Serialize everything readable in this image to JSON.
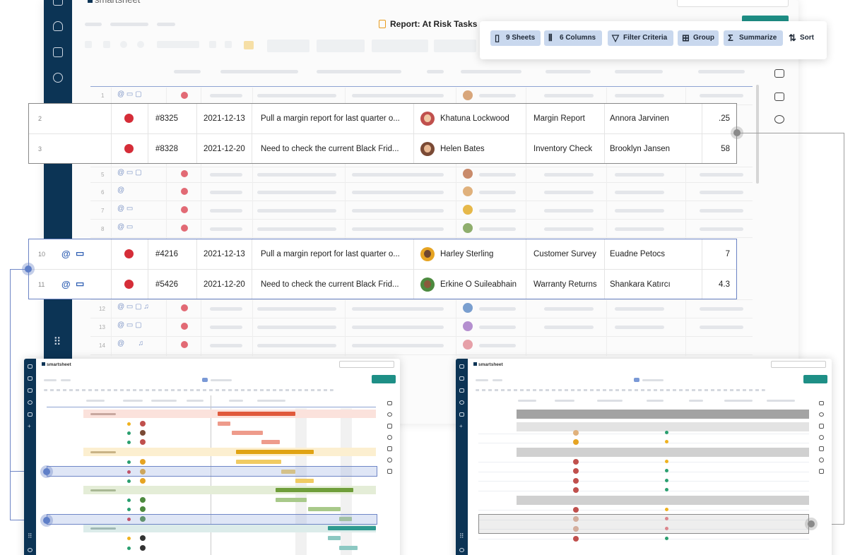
{
  "app": {
    "brand": "smartsheet",
    "mini_brand": "smartsheet"
  },
  "report": {
    "title": "Report: At Risk Tasks"
  },
  "toolbar": {
    "sheets": "9 Sheets",
    "columns": "6 Columns",
    "filter": "Filter Criteria",
    "group": "Group",
    "summarize": "Summarize",
    "sort": "Sort"
  },
  "faded_rows": [
    {
      "num": "1",
      "icons": "@ ▭ ▢"
    },
    {
      "num": "5",
      "icons": "@ ▭ ▢"
    },
    {
      "num": "6",
      "icons": "@"
    },
    {
      "num": "7",
      "icons": "@ ▭"
    },
    {
      "num": "8",
      "icons": "@ ▭"
    },
    {
      "num": "12",
      "icons": "@ ▭ ▢ ♫"
    },
    {
      "num": "13",
      "icons": "@ ▭ ▢"
    },
    {
      "num": "14",
      "icons": "@       ♫"
    }
  ],
  "highlight_top": [
    {
      "num": "2",
      "id": "#8325",
      "date": "2021-12-13",
      "task": "Pull a margin report for last quarter o...",
      "assignee": "Khatuna Lockwood",
      "category": "Margin Report",
      "owner": "Annora Jarvinen",
      "value": ".25"
    },
    {
      "num": "3",
      "id": "#8328",
      "date": "2021-12-20",
      "task": "Need to check the current Black Frid...",
      "assignee": "Helen Bates",
      "category": "Inventory Check",
      "owner": "Brooklyn Jansen",
      "value": "58"
    }
  ],
  "highlight_bottom": [
    {
      "num": "10",
      "id": "#4216",
      "date": "2021-12-13",
      "task": "Pull a margin report for last quarter o...",
      "assignee": "Harley Sterling",
      "category": "Customer Survey",
      "owner": "Euadne Petocs",
      "value": "7"
    },
    {
      "num": "11",
      "id": "#5426",
      "date": "2021-12-20",
      "task": "Need to check the current Black Frid...",
      "assignee": "Erkine O Suileabhain",
      "category": "Warranty Returns",
      "owner": "Shankara Katırcı",
      "value": "4.3"
    }
  ],
  "colors": {
    "nav": "#0c3455",
    "status_red": "#d52d38",
    "toolbar_highlight": "#c9d8ee",
    "teal": "#1e8f86",
    "accent_orange": "#e89b1d"
  },
  "icons": {
    "report": "report-icon",
    "sheets": "sheet-icon",
    "columns": "columns-icon",
    "filter": "filter-icon",
    "group": "group-icon",
    "summarize": "sigma-icon",
    "sort": "sort-icon"
  }
}
